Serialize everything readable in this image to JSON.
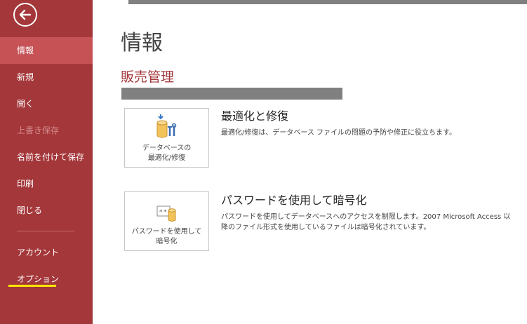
{
  "sidebar": {
    "items": [
      {
        "label": "情報",
        "selected": true
      },
      {
        "label": "新規"
      },
      {
        "label": "開く"
      },
      {
        "label": "上書き保存",
        "disabled": true
      },
      {
        "label": "名前を付けて保存"
      },
      {
        "label": "印刷"
      },
      {
        "label": "閉じる"
      }
    ],
    "bottom_items": [
      {
        "label": "アカウント"
      },
      {
        "label": "オプション"
      }
    ]
  },
  "main": {
    "title": "情報",
    "database_name": "販売管理",
    "sections": [
      {
        "tile_line1": "データベースの",
        "tile_line2": "最適化/修復",
        "title": "最適化と修復",
        "description": "最適化/修復は、データベース ファイルの問題の予防や修正に役立ちます。"
      },
      {
        "tile_line1": "パスワードを使用して",
        "tile_line2": "暗号化",
        "title": "パスワードを使用して暗号化",
        "description": "パスワードを使用してデータベースへのアクセスを制限します。2007 Microsoft Access 以降のファイル形式を使用しているファイルは暗号化されています。"
      }
    ]
  },
  "icons": {
    "back": "back-arrow-icon",
    "compact": "database-compact-repair-icon",
    "encrypt": "database-password-icon"
  },
  "colors": {
    "sidebar": "#a4373a",
    "selected": "#c65256",
    "accent_underline": "#ffe600",
    "database_name": "#a4373a"
  }
}
